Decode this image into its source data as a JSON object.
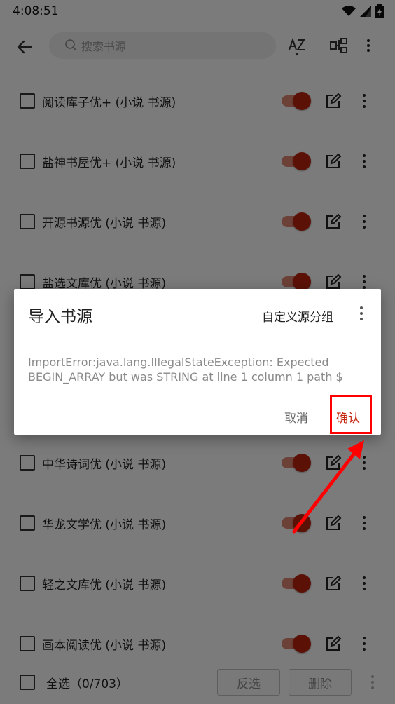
{
  "status_bar": {
    "time": "4:08:51",
    "icons": [
      "wifi-icon",
      "cell-signal-icon",
      "battery-charging-icon"
    ]
  },
  "toolbar": {
    "search_placeholder": "搜索书源",
    "icons": [
      "back-arrow-icon",
      "search-icon",
      "sort-az-icon",
      "group-tree-icon",
      "more-vert-icon"
    ]
  },
  "sources": [
    {
      "name": "阅读库子优+ (小说 书源)",
      "enabled": true
    },
    {
      "name": "盐神书屋优+ (小说 书源)",
      "enabled": true
    },
    {
      "name": "开源书源优 (小说 书源)",
      "enabled": true
    },
    {
      "name": "盐选文库优 (小说 书源)",
      "enabled": true
    },
    {
      "name": "中华诗词优 (小说 书源)",
      "enabled": true
    },
    {
      "name": "华龙文学优 (小说 书源)",
      "enabled": true
    },
    {
      "name": "轻之文库优 (小说 书源)",
      "enabled": true
    },
    {
      "name": "画本阅读优 (小说 书源)",
      "enabled": true
    }
  ],
  "bottom_bar": {
    "select_all": "全选（0/703）",
    "invert_button": "反选",
    "delete_button": "删除"
  },
  "dialog": {
    "title": "导入书源",
    "custom_group": "自定义源分组",
    "message": "ImportError:java.lang.IllegalStateException: Expected BEGIN_ARRAY but was STRING at line 1 column 1 path $",
    "cancel": "取消",
    "confirm": "确认"
  },
  "colors": {
    "accent": "#b8230f",
    "toggle_track": "#d9826f",
    "annotation": "#ff0000"
  }
}
